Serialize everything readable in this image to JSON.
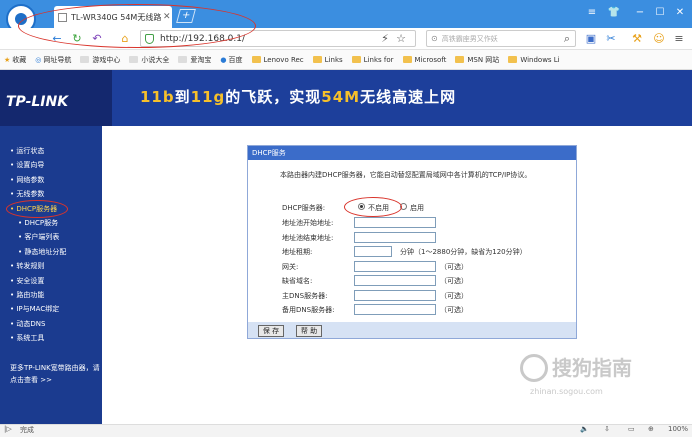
{
  "browser": {
    "tab_title": "TL-WR340G 54M无线路",
    "url": "http://192.168.0.1/",
    "search_placeholder": "高铁霸座男又作妖",
    "bookmarks": [
      "收藏",
      "网址导航",
      "游戏中心",
      "小说大全",
      "爱淘宝",
      "百度",
      "Lenovo Rec",
      "Links",
      "Links for",
      "Microsoft",
      "MSN 网站",
      "Windows Li"
    ],
    "status": "完成",
    "zoom": "100%"
  },
  "header": {
    "logo": "TP-LINK",
    "banner_parts": [
      {
        "text": "11b",
        "yellow": true
      },
      {
        "text": "到",
        "yellow": false
      },
      {
        "text": "11g",
        "yellow": true
      },
      {
        "text": "的飞跃，实现",
        "yellow": false
      },
      {
        "text": "54M",
        "yellow": true
      },
      {
        "text": "无线高速上网",
        "yellow": false
      }
    ]
  },
  "sidebar": {
    "items": [
      {
        "label": "• 运行状态",
        "sub": false,
        "active": false
      },
      {
        "label": "• 设置向导",
        "sub": false,
        "active": false
      },
      {
        "label": "• 网络参数",
        "sub": false,
        "active": false
      },
      {
        "label": "• 无线参数",
        "sub": false,
        "active": false
      },
      {
        "label": "• DHCP服务器",
        "sub": false,
        "active": true
      },
      {
        "label": "• DHCP服务",
        "sub": true,
        "active": false
      },
      {
        "label": "• 客户端列表",
        "sub": true,
        "active": false
      },
      {
        "label": "• 静态地址分配",
        "sub": true,
        "active": false
      },
      {
        "label": "• 转发规则",
        "sub": false,
        "active": false
      },
      {
        "label": "• 安全设置",
        "sub": false,
        "active": false
      },
      {
        "label": "• 路由功能",
        "sub": false,
        "active": false
      },
      {
        "label": "• IP与MAC绑定",
        "sub": false,
        "active": false
      },
      {
        "label": "• 动态DNS",
        "sub": false,
        "active": false
      },
      {
        "label": "• 系统工具",
        "sub": false,
        "active": false
      }
    ],
    "more_text": "更多TP-LINK宽带路由器，请点击查看 >>"
  },
  "panel": {
    "title": "DHCP服务",
    "description": "本路由器内建DHCP服务器，它能自动替您配置局域网中各计算机的TCP/IP协议。",
    "dhcp_label": "DHCP服务器:",
    "option_off": "不启用",
    "option_on": "启用",
    "fields": [
      {
        "label": "地址池开始地址:",
        "value": "",
        "note": ""
      },
      {
        "label": "地址池结束地址:",
        "value": "",
        "note": ""
      },
      {
        "label": "地址租期:",
        "value": "",
        "note": "分钟（1～2880分钟，缺省为120分钟）"
      },
      {
        "label": "网关:",
        "value": "",
        "note": "（可选）"
      },
      {
        "label": "缺省域名:",
        "value": "",
        "note": "（可选）"
      },
      {
        "label": "主DNS服务器:",
        "value": "",
        "note": "（可选）"
      },
      {
        "label": "备用DNS服务器:",
        "value": "",
        "note": "（可选）"
      }
    ],
    "save_label": "保 存",
    "help_label": "帮 助"
  },
  "watermark": {
    "text": "搜狗指南",
    "url": "zhinan.sogou.com"
  }
}
